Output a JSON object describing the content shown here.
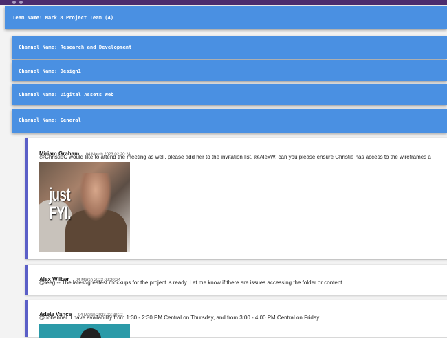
{
  "team": {
    "label": "Team Name: Mark 8 Project Team (4)"
  },
  "channels": [
    {
      "label": "Channel Name: Research and Development"
    },
    {
      "label": "Channel Name: Design1"
    },
    {
      "label": "Channel Name: Digital Assets Web"
    },
    {
      "label": "Channel Name: General"
    }
  ],
  "messages": [
    {
      "author": "Miriam Graham",
      "time": "04 March 2023 02:20:24",
      "text": "@ChristieC would like to attend the meeting as well, please add her to the invitation list. @AlexW, can you please ensure Christie has access to the wireframes a",
      "image_caption_line1": "just",
      "image_caption_line2": "FYI."
    },
    {
      "author": "Alex Wilber",
      "time": "04 March 2023 02:20:24",
      "text": "@leeg -- The latest/greatest mockups for the project is ready. Let me know if there are issues accessing the folder or content."
    },
    {
      "author": "Adele Vance",
      "time": "04 March 2023 02:20:22",
      "text": "@JohannaL I have availability from 1:30 - 2:30 PM Central on Thursday, and from 3:00 - 4:00 PM Central on Friday."
    }
  ],
  "colors": {
    "bar": "#4a90e2",
    "accent": "#5b5fc7",
    "background": "#f3f3f3"
  }
}
